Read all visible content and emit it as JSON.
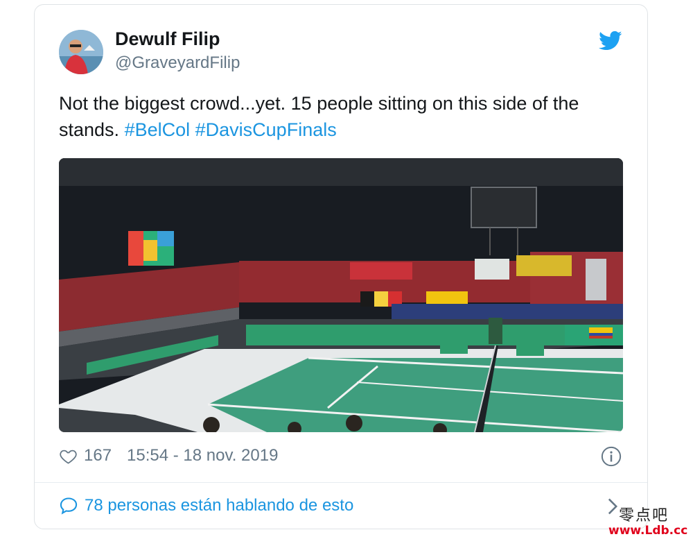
{
  "author": {
    "name": "Dewulf Filip",
    "handle": "@GraveyardFilip",
    "avatar_icon": "person-avatar"
  },
  "tweet": {
    "text_part1": "Not the biggest crowd...yet. 15 people sitting on this side of the stands. ",
    "hashtag1": "#BelCol",
    "hashtag2": "#DavisCupFinals"
  },
  "photo": {
    "icon": "tennis-arena-photo"
  },
  "meta": {
    "likes": "167",
    "timestamp": "15:54 - 18 nov. 2019"
  },
  "conversation": {
    "label": "78 personas están hablando de esto"
  },
  "watermark": {
    "text": "零点吧",
    "url": "www.Ldb.cc"
  },
  "colors": {
    "twitter_blue": "#1da1f2",
    "link_blue": "#1b95e0",
    "muted_gray": "#657786",
    "court_green": "#3f9e7e"
  }
}
